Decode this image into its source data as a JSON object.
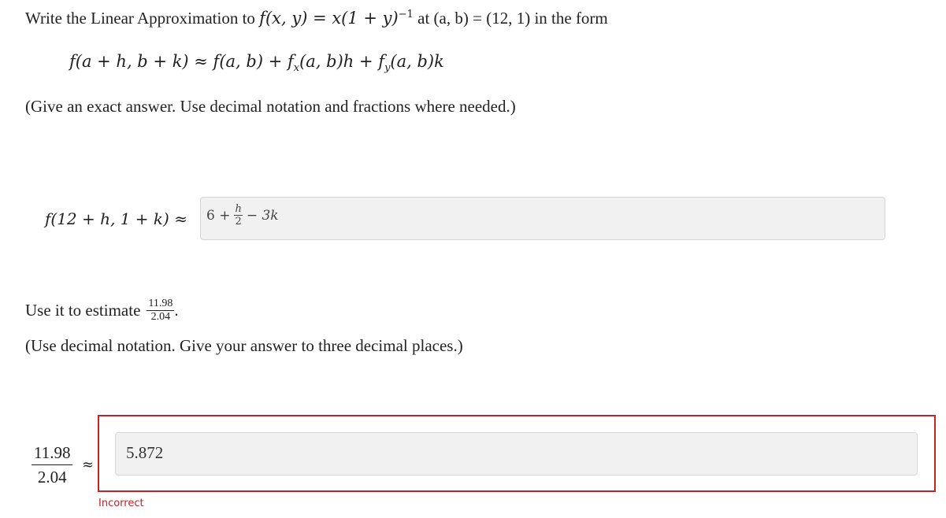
{
  "problem": {
    "intro": "Write the Linear Approximation to ",
    "function_lhs": "f(x, y) = x(1 + y)",
    "exponent": "−1",
    "at_text": " at (a, b) = (12, 1) in the form",
    "formula": "f(a + h, b + k) ≈ f(a, b) + f",
    "fx_sub": "x",
    "formula_mid": "(a, b)h + f",
    "fy_sub": "y",
    "formula_end": "(a, b)k",
    "instruction": "(Give an exact answer. Use decimal notation and fractions where needed.)"
  },
  "answer1": {
    "label": "f(12 + h, 1 + k) ≈",
    "term_const": "6 +",
    "frac_num": "h",
    "frac_den": "2",
    "term_rest": "− 3k"
  },
  "estimate": {
    "prefix": "Use it to estimate",
    "num": "11.98",
    "den": "2.04",
    "suffix": ".",
    "instruction": "(Use decimal notation. Give your answer to three decimal places.)"
  },
  "answer2": {
    "lhs_num": "11.98",
    "lhs_den": "2.04",
    "approx": "≈",
    "value": "5.872",
    "feedback": "Incorrect"
  },
  "colors": {
    "error": "#c22426",
    "input_bg": "#f1f1f1"
  }
}
